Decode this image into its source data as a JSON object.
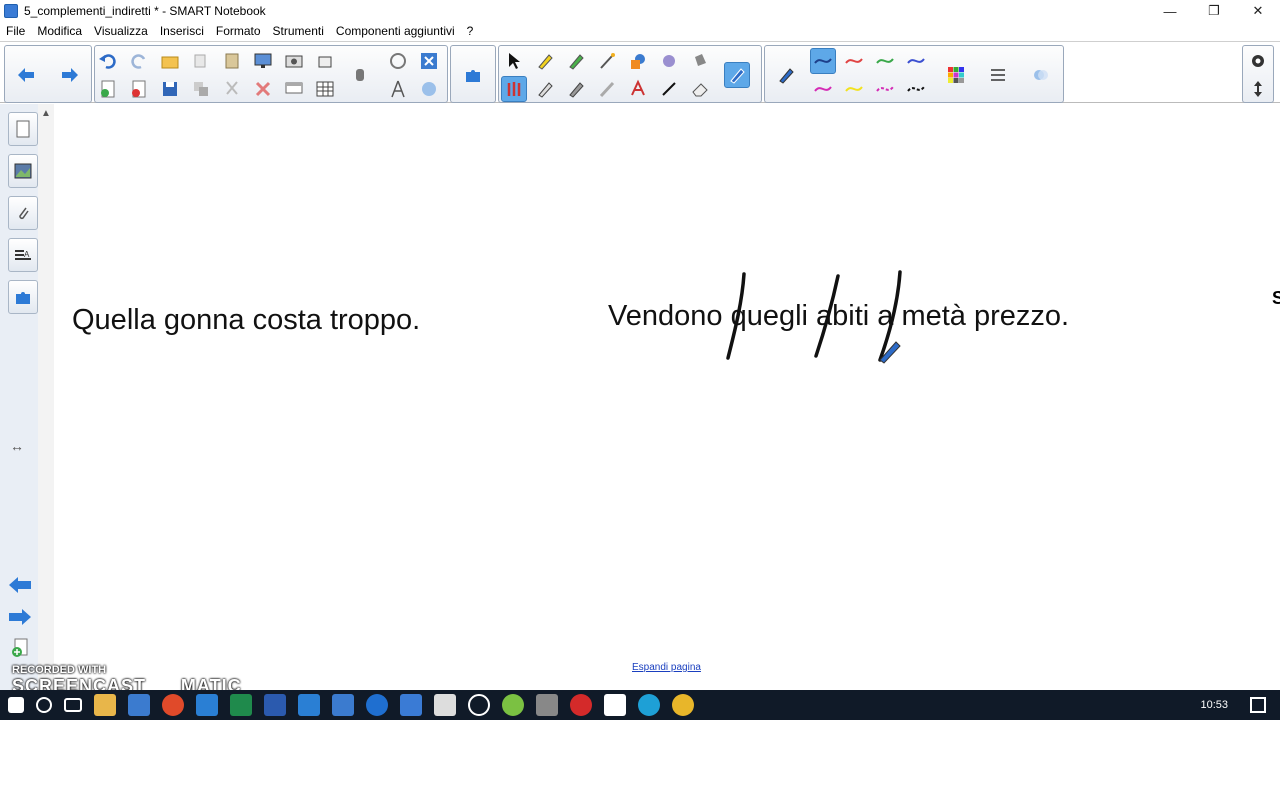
{
  "window": {
    "title": "5_complementi_indiretti * - SMART Notebook"
  },
  "menu": [
    "File",
    "Modifica",
    "Visualizza",
    "Inserisci",
    "Formato",
    "Strumenti",
    "Componenti aggiuntivi",
    "?"
  ],
  "canvas": {
    "sentence_left": "Quella gonna costa troppo.",
    "sentence_right": "Vendono quegli abiti a metà prezzo.",
    "expand_link": "Espandi pagina"
  },
  "taskbar": {
    "time": "10:53"
  },
  "watermark": {
    "line1": "RECORDED WITH",
    "line2": "SCREENCAST",
    "line3": "MATIC"
  },
  "colors": {
    "toolbar_selected": "#5ea8e8",
    "taskbar": "#101a28",
    "sidebar": "#e9eef5"
  }
}
